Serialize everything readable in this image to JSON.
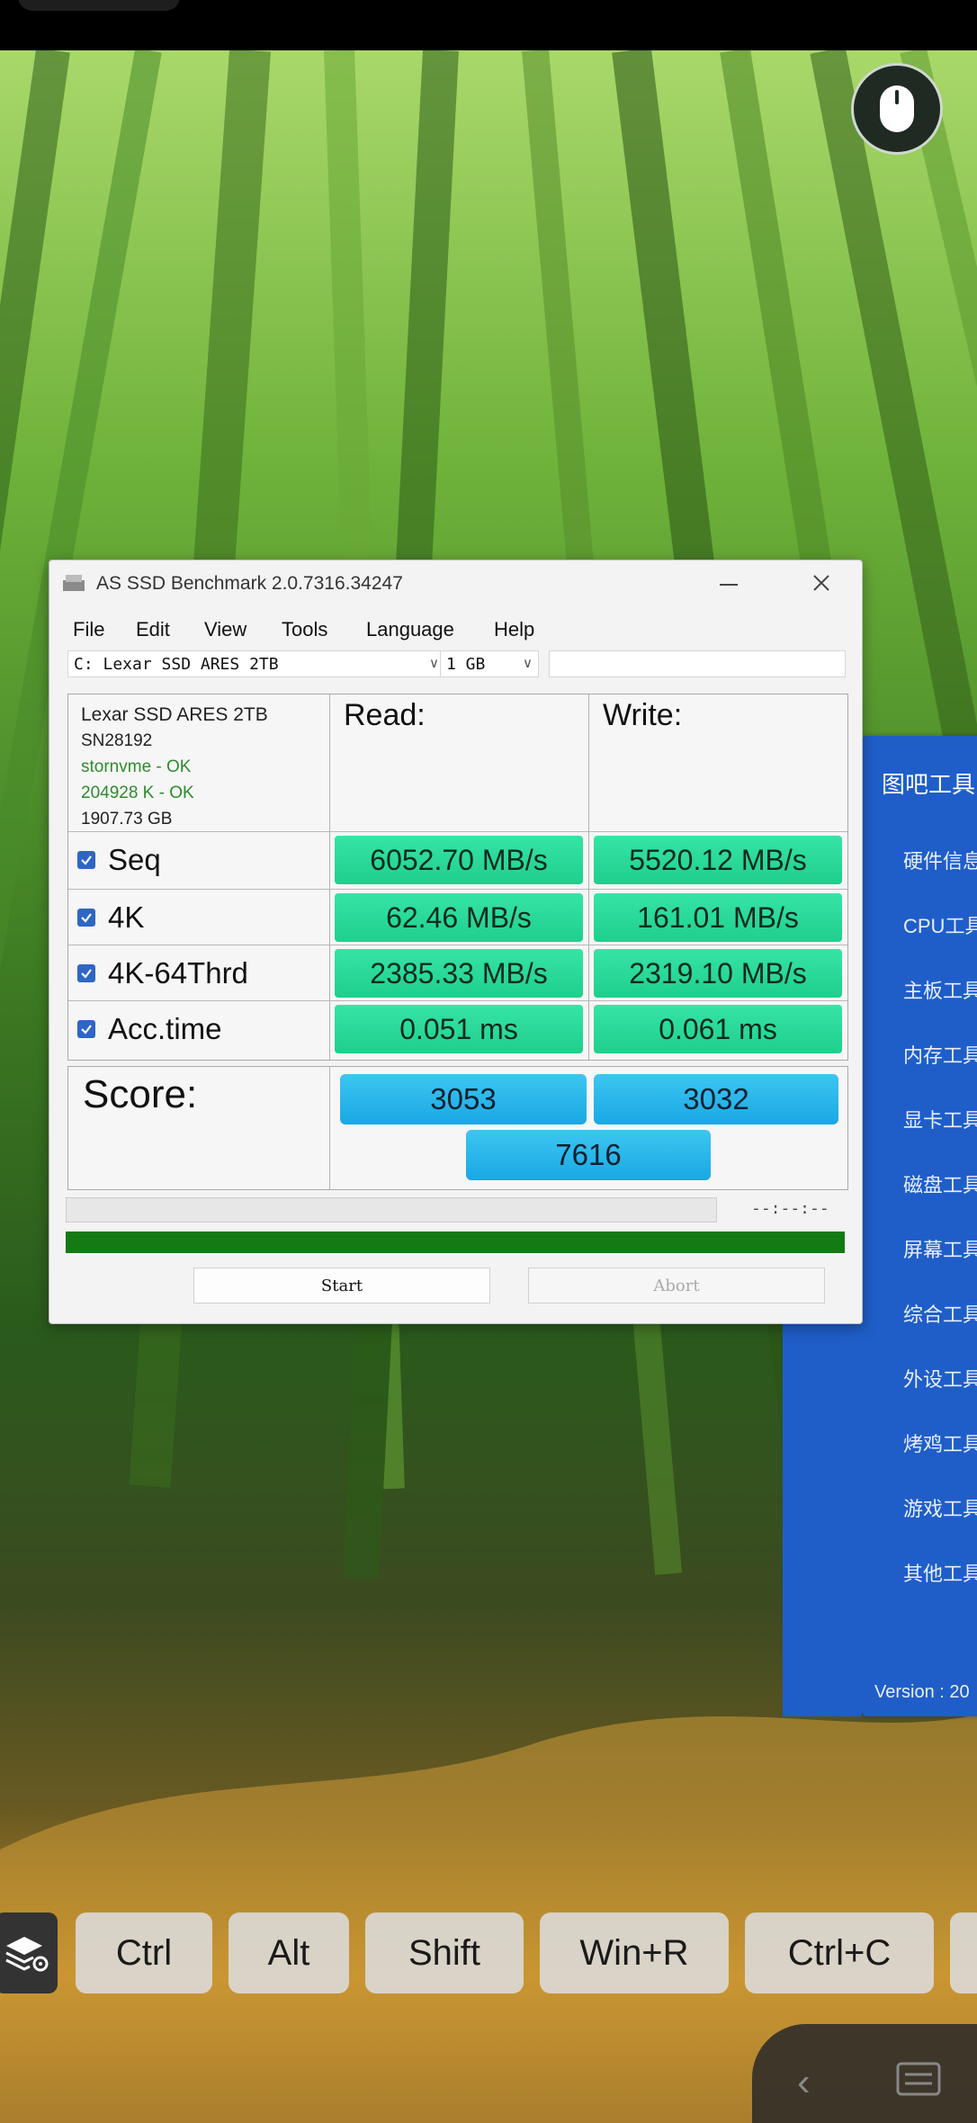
{
  "window": {
    "title": "AS SSD Benchmark 2.0.7316.34247",
    "menu": [
      "File",
      "Edit",
      "View",
      "Tools",
      "Language",
      "Help"
    ],
    "drive_select": "C: Lexar SSD ARES 2TB",
    "size_select": "1 GB",
    "drive_info": {
      "name": "Lexar SSD ARES 2TB",
      "serial": "SN28192",
      "driver": "stornvme - OK",
      "alignment": "204928 K - OK",
      "capacity": "1907.73 GB"
    },
    "headers": {
      "read": "Read:",
      "write": "Write:"
    },
    "rows": [
      {
        "label": "Seq",
        "read": "6052.70 MB/s",
        "write": "5520.12 MB/s"
      },
      {
        "label": "4K",
        "read": "62.46 MB/s",
        "write": "161.01 MB/s"
      },
      {
        "label": "4K-64Thrd",
        "read": "2385.33 MB/s",
        "write": "2319.10 MB/s"
      },
      {
        "label": "Acc.time",
        "read": "0.051 ms",
        "write": "0.061 ms"
      }
    ],
    "score": {
      "label": "Score:",
      "read": "3053",
      "write": "3032",
      "total": "7616"
    },
    "time_display": "--:--:--",
    "start_label": "Start",
    "abort_label": "Abort"
  },
  "side_panel": {
    "title": "图吧工具",
    "items": [
      "硬件信息",
      "CPU工具",
      "主板工具",
      "内存工具",
      "显卡工具",
      "磁盘工具",
      "屏幕工具",
      "综合工具",
      "外设工具",
      "烤鸡工具",
      "游戏工具",
      "其他工具"
    ],
    "version": "Version : 20"
  },
  "keys": [
    "Ctrl",
    "Alt",
    "Shift",
    "Win+R",
    "Ctrl+C"
  ]
}
